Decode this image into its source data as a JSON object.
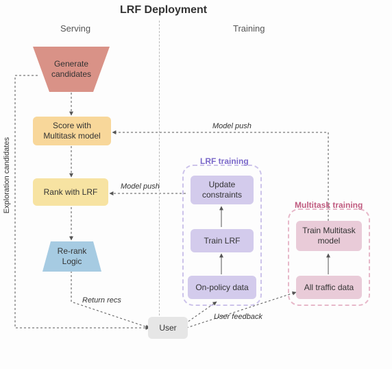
{
  "title": "LRF Deployment",
  "sections": {
    "serving": "Serving",
    "training": "Training"
  },
  "axis_label": "Exploration candidates",
  "nodes": {
    "gen_candidates": "Generate candidates",
    "score": {
      "l1": "Score with",
      "l2": "Multitask model"
    },
    "rank_lrf": "Rank with LRF",
    "rerank": {
      "l1": "Re-rank",
      "l2": "Logic"
    },
    "user": "User",
    "update_constraints": {
      "l1": "Update",
      "l2": "constraints"
    },
    "train_lrf": "Train LRF",
    "onpolicy": "On-policy data",
    "train_multitask": {
      "l1": "Train Multitask",
      "l2": "model"
    },
    "all_traffic": "All traffic data"
  },
  "groups": {
    "lrf_training": "LRF training",
    "multitask_training": "Multitask training"
  },
  "edges": {
    "model_push_top": "Model push",
    "model_push_mid": "Model push",
    "return_recs": "Return recs",
    "user_feedback": "User feedback"
  },
  "colors": {
    "gen": "#d99287",
    "score": "#f8d79a",
    "rank": "#f7e3a2",
    "rerank": "#a6cbe2",
    "user": "#e6e6e6",
    "lrf_box": "#ccc3ea",
    "lrf_label": "#7a68c9",
    "lrf_node": "#d3cbec",
    "mt_box": "#e7b8c9",
    "mt_label": "#c05a7f",
    "mt_node": "#e9cbd8"
  }
}
